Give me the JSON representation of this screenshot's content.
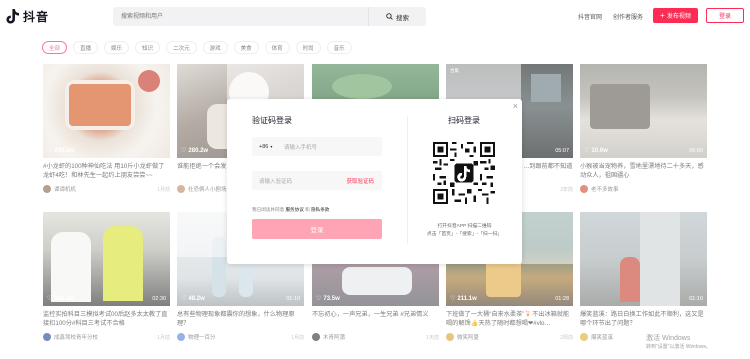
{
  "header": {
    "logo_text": "抖音",
    "search_placeholder": "搜索视频和用户",
    "search_button": "搜索",
    "links": [
      "抖音官网",
      "创作者服务"
    ],
    "publish_button": "发布视频",
    "login_button": "登录"
  },
  "categories": [
    "全部",
    "直播",
    "娱乐",
    "知识",
    "二次元",
    "游戏",
    "美食",
    "体育",
    "时尚",
    "音乐"
  ],
  "videos": [
    {
      "likes": "243.3w",
      "duration": "",
      "title": "#小龙虾的100种神仙吃法 用10斤小龙虾做了龙虾4吃！和林先生一起约上朋友尝尝~~",
      "author": "谭谭机机",
      "time": "1月前"
    },
    {
      "likes": "280.2w",
      "duration": "",
      "title": "谁能拒绝一个会发... 搞笑日常",
      "author": "社恐俩人小剧场",
      "time": ""
    },
    {
      "likes": "",
      "duration": "",
      "title": "",
      "author": "",
      "time": ""
    },
    {
      "likes": "",
      "duration": "05:07",
      "title": "...到跟前都不知道",
      "author": "",
      "time": "2年前"
    },
    {
      "likes": "10.0w",
      "duration": "06:00",
      "title": "小猴被当宠物养，雪地里漂地待二十多天，感动众人，祖国疆心",
      "author": "老不多故事",
      "time": ""
    },
    {
      "likes": "198.3w",
      "duration": "02:30",
      "title": "监控实拍科目三模拟考试00后赵多太太教了直接扣100分#科目三考试不合格",
      "author": "成鑫驾校青年分校",
      "time": "1月前"
    },
    {
      "likes": "48.2w",
      "duration": "01:10",
      "title": "总有些物理现象都震你的想象，什么物理原理？",
      "author": "物理一百分",
      "time": "1月前"
    },
    {
      "likes": "73.5w",
      "duration": "",
      "title": "不忘初心，一声兄弟，一生兄弟 #兄弟情义",
      "author": "木青阿蒲",
      "time": "1天前"
    },
    {
      "likes": "211.1w",
      "duration": "01:28",
      "title": "下班做了一大桶“自来水柔茶”🍹不出冰箱就能喝的解馋👍天热了随时都想喝❤#vlo…",
      "author": "微笑阿夏",
      "time": "2周前"
    },
    {
      "likes": "",
      "duration": "01:10",
      "title": "爆笑蓝溪：路日白换工作如此不顺利，这又是哪个环节出了问题？",
      "author": "爆笑蓝溪",
      "time": ""
    }
  ],
  "modal": {
    "title_left": "验证码登录",
    "phone_prefix": "+86",
    "phone_placeholder": "请输入手机号",
    "code_placeholder": "请输入验证码",
    "get_code": "获取验证码",
    "agreement_prefix": "我已阅读并同意",
    "agreement_service": "服务协议",
    "agreement_and": "和",
    "agreement_privacy": "隐私条款",
    "login_button": "登录",
    "title_right": "扫码登录",
    "scan_tip_1": "打开抖音APP 扫描二维码",
    "scan_tip_2": "点击「首页」-「搜索」-「扫一扫」",
    "close": "×"
  },
  "watermark": {
    "line1": "激活 Windows",
    "line2": "转到“设置”以激活 Windows。"
  },
  "colors": {
    "accent": "#fe2c55",
    "login_disabled": "#fea4b4"
  }
}
